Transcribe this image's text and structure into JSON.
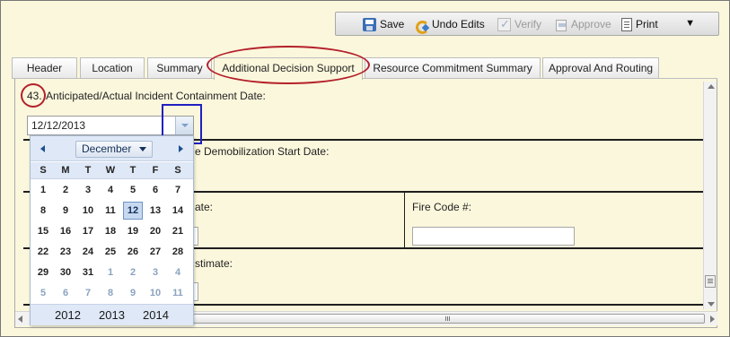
{
  "toolbar": {
    "save": "Save",
    "undo": "Undo Edits",
    "verify": "Verify",
    "approve": "Approve",
    "print": "Print",
    "more_icon": "▼"
  },
  "tabs": [
    "Header",
    "Location",
    "Summary",
    "Additional Decision Support",
    "Resource Commitment Summary",
    "Approval And Routing"
  ],
  "active_tab": "Additional Decision Support",
  "form": {
    "q43_number": "43.",
    "q43_label": "Anticipated/Actual Incident Containment Date:",
    "q43_value": "12/12/2013",
    "q44_label_partial": "e Demobilization Start Date:",
    "q45_label_partial": "ate:",
    "fire_code_label": "Fire Code #:",
    "fire_code_value": "",
    "q46_label_partial": "stimate:"
  },
  "datepicker": {
    "month": "December",
    "weekdays": [
      "S",
      "M",
      "T",
      "W",
      "T",
      "F",
      "S"
    ],
    "weeks": [
      [
        "1",
        "2",
        "3",
        "4",
        "5",
        "6",
        "7"
      ],
      [
        "8",
        "9",
        "10",
        "11",
        "12",
        "13",
        "14"
      ],
      [
        "15",
        "16",
        "17",
        "18",
        "19",
        "20",
        "21"
      ],
      [
        "22",
        "23",
        "24",
        "25",
        "26",
        "27",
        "28"
      ],
      [
        "29",
        "30",
        "31",
        "1",
        "2",
        "3",
        "4"
      ],
      [
        "5",
        "6",
        "7",
        "8",
        "9",
        "10",
        "11"
      ]
    ],
    "selected": "12",
    "years": [
      "2012",
      "2013",
      "2014"
    ],
    "current_year": "2013"
  },
  "colors": {
    "panel_bg": "#fbf7dc",
    "annotation_red": "#b4202a",
    "annotation_blue": "#2020c0",
    "picker_header": "#dfe8f6"
  }
}
